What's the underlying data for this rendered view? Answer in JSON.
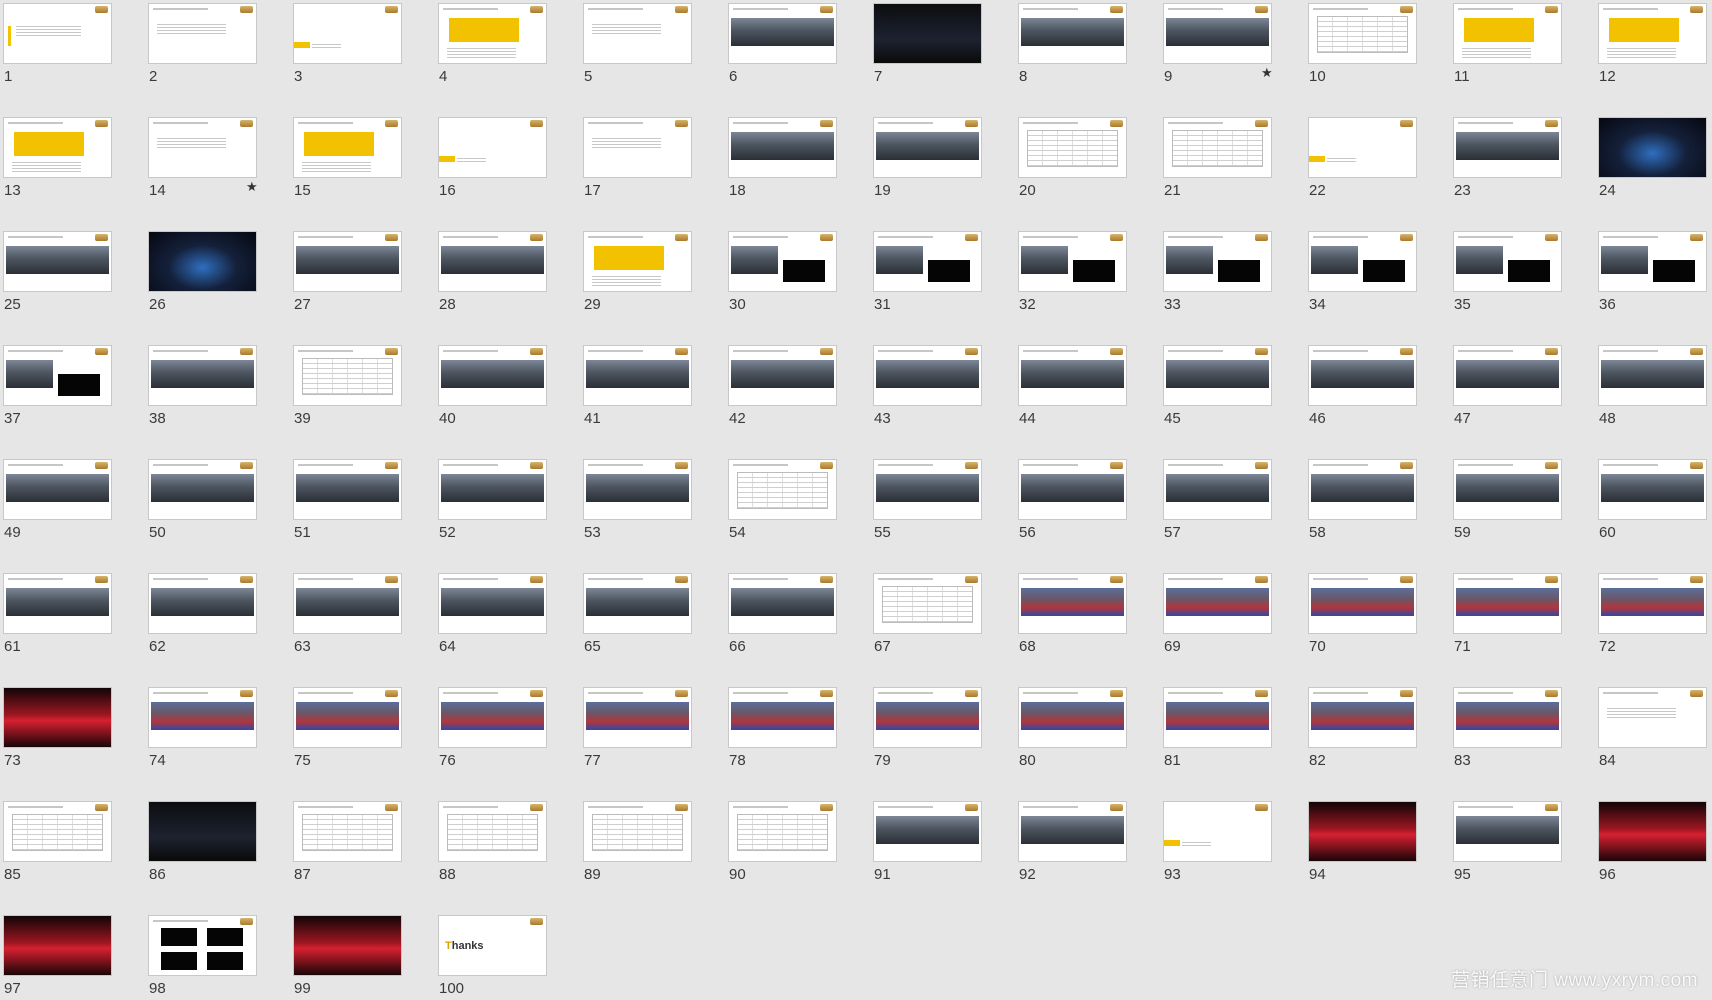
{
  "window": {
    "view": "slide-sorter",
    "slide_count": 100
  },
  "slides": [
    {
      "n": "1",
      "style": "title"
    },
    {
      "n": "2",
      "style": "text"
    },
    {
      "n": "3",
      "style": "section"
    },
    {
      "n": "4",
      "style": "yellow"
    },
    {
      "n": "5",
      "style": "text"
    },
    {
      "n": "6",
      "style": "photo"
    },
    {
      "n": "7",
      "style": "night"
    },
    {
      "n": "8",
      "style": "photo"
    },
    {
      "n": "9",
      "style": "photo",
      "star": true
    },
    {
      "n": "10",
      "style": "table"
    },
    {
      "n": "11",
      "style": "yellow"
    },
    {
      "n": "12",
      "style": "yellow"
    },
    {
      "n": "13",
      "style": "yellow"
    },
    {
      "n": "14",
      "style": "text",
      "star": true
    },
    {
      "n": "15",
      "style": "yellow"
    },
    {
      "n": "16",
      "style": "section"
    },
    {
      "n": "17",
      "style": "text"
    },
    {
      "n": "18",
      "style": "photo"
    },
    {
      "n": "19",
      "style": "photo"
    },
    {
      "n": "20",
      "style": "table"
    },
    {
      "n": "21",
      "style": "table"
    },
    {
      "n": "22",
      "style": "section"
    },
    {
      "n": "23",
      "style": "photo"
    },
    {
      "n": "24",
      "style": "dark"
    },
    {
      "n": "25",
      "style": "photo"
    },
    {
      "n": "26",
      "style": "dark"
    },
    {
      "n": "27",
      "style": "photo"
    },
    {
      "n": "28",
      "style": "photo"
    },
    {
      "n": "29",
      "style": "yellow"
    },
    {
      "n": "30",
      "style": "black"
    },
    {
      "n": "31",
      "style": "black"
    },
    {
      "n": "32",
      "style": "black"
    },
    {
      "n": "33",
      "style": "black"
    },
    {
      "n": "34",
      "style": "black"
    },
    {
      "n": "35",
      "style": "black"
    },
    {
      "n": "36",
      "style": "black"
    },
    {
      "n": "37",
      "style": "black"
    },
    {
      "n": "38",
      "style": "photo"
    },
    {
      "n": "39",
      "style": "table"
    },
    {
      "n": "40",
      "style": "photo"
    },
    {
      "n": "41",
      "style": "photo"
    },
    {
      "n": "42",
      "style": "photo"
    },
    {
      "n": "43",
      "style": "photo"
    },
    {
      "n": "44",
      "style": "photo"
    },
    {
      "n": "45",
      "style": "photo"
    },
    {
      "n": "46",
      "style": "photo"
    },
    {
      "n": "47",
      "style": "photo"
    },
    {
      "n": "48",
      "style": "photo"
    },
    {
      "n": "49",
      "style": "photo"
    },
    {
      "n": "50",
      "style": "photo"
    },
    {
      "n": "51",
      "style": "photo"
    },
    {
      "n": "52",
      "style": "photo"
    },
    {
      "n": "53",
      "style": "photo"
    },
    {
      "n": "54",
      "style": "table"
    },
    {
      "n": "55",
      "style": "photo"
    },
    {
      "n": "56",
      "style": "photo"
    },
    {
      "n": "57",
      "style": "photo"
    },
    {
      "n": "58",
      "style": "photo"
    },
    {
      "n": "59",
      "style": "photo"
    },
    {
      "n": "60",
      "style": "photo"
    },
    {
      "n": "61",
      "style": "photo"
    },
    {
      "n": "62",
      "style": "photo"
    },
    {
      "n": "63",
      "style": "photo"
    },
    {
      "n": "64",
      "style": "photo"
    },
    {
      "n": "65",
      "style": "photo"
    },
    {
      "n": "66",
      "style": "photo"
    },
    {
      "n": "67",
      "style": "table"
    },
    {
      "n": "68",
      "style": "crowd"
    },
    {
      "n": "69",
      "style": "crowd"
    },
    {
      "n": "70",
      "style": "crowd"
    },
    {
      "n": "71",
      "style": "crowd"
    },
    {
      "n": "72",
      "style": "crowd"
    },
    {
      "n": "73",
      "style": "red"
    },
    {
      "n": "74",
      "style": "crowd"
    },
    {
      "n": "75",
      "style": "crowd"
    },
    {
      "n": "76",
      "style": "crowd"
    },
    {
      "n": "77",
      "style": "crowd"
    },
    {
      "n": "78",
      "style": "crowd"
    },
    {
      "n": "79",
      "style": "crowd"
    },
    {
      "n": "80",
      "style": "crowd"
    },
    {
      "n": "81",
      "style": "crowd"
    },
    {
      "n": "82",
      "style": "crowd"
    },
    {
      "n": "83",
      "style": "crowd"
    },
    {
      "n": "84",
      "style": "text"
    },
    {
      "n": "85",
      "style": "table"
    },
    {
      "n": "86",
      "style": "night"
    },
    {
      "n": "87",
      "style": "table"
    },
    {
      "n": "88",
      "style": "table"
    },
    {
      "n": "89",
      "style": "table"
    },
    {
      "n": "90",
      "style": "table"
    },
    {
      "n": "91",
      "style": "photo"
    },
    {
      "n": "92",
      "style": "photo"
    },
    {
      "n": "93",
      "style": "section"
    },
    {
      "n": "94",
      "style": "red"
    },
    {
      "n": "95",
      "style": "photo"
    },
    {
      "n": "96",
      "style": "red"
    },
    {
      "n": "97",
      "style": "red"
    },
    {
      "n": "98",
      "style": "black4"
    },
    {
      "n": "99",
      "style": "red"
    },
    {
      "n": "100",
      "style": "thanks"
    }
  ],
  "thanks_slide": {
    "cap": "T",
    "rest": "hanks"
  },
  "watermark": "营销任意门 www.yxrym.com",
  "colors": {
    "background": "#e6e6e6",
    "accent": "#f2c200",
    "logo": "#c8a050"
  }
}
